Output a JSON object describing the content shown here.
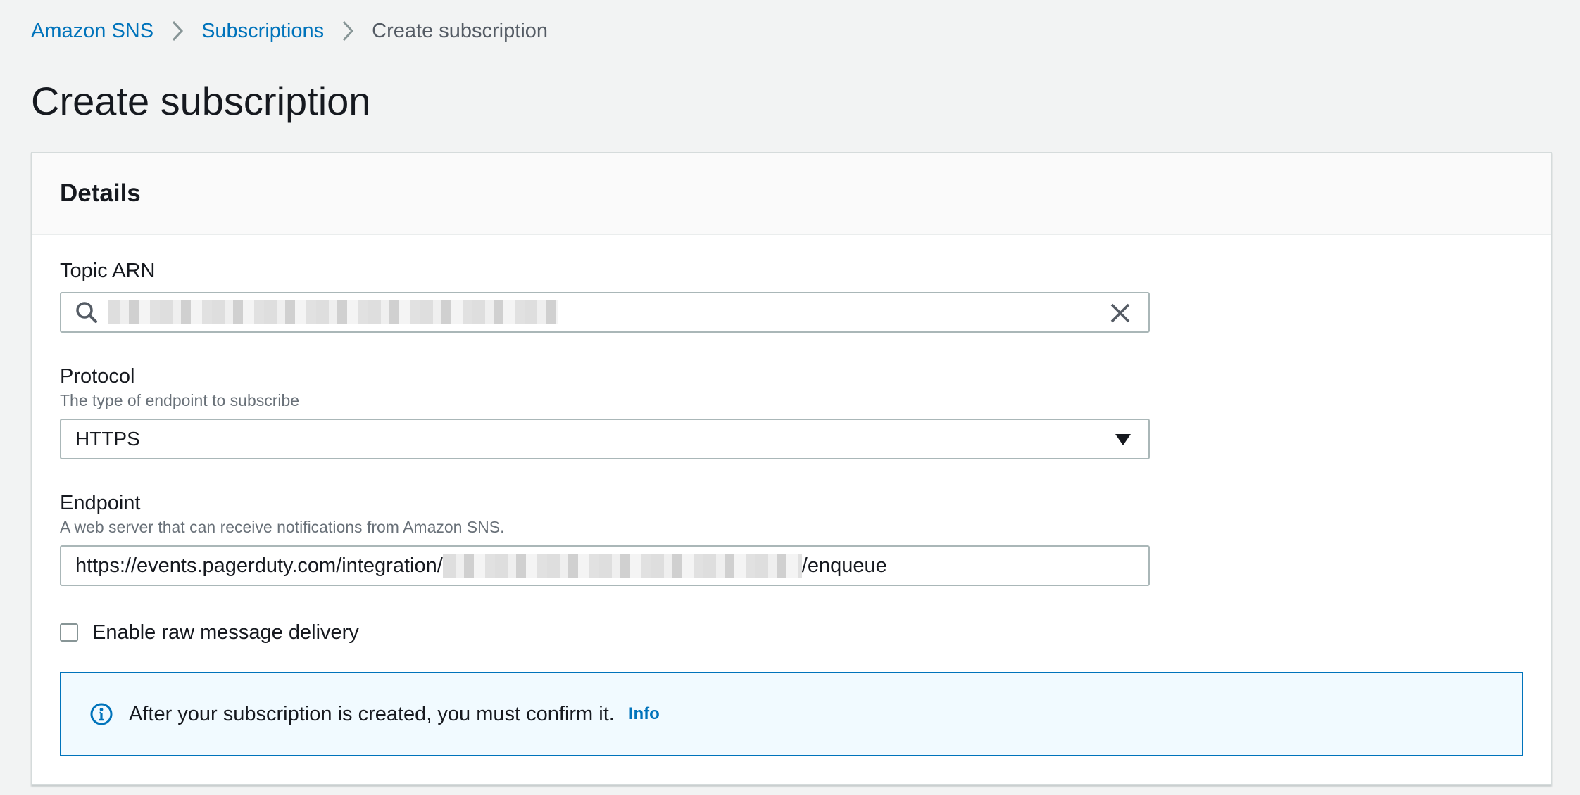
{
  "breadcrumb": {
    "items": [
      {
        "label": "Amazon SNS"
      },
      {
        "label": "Subscriptions"
      },
      {
        "label": "Create subscription"
      }
    ]
  },
  "page": {
    "title": "Create subscription"
  },
  "details": {
    "title": "Details",
    "topic_arn": {
      "label": "Topic ARN",
      "value": ""
    },
    "protocol": {
      "label": "Protocol",
      "description": "The type of endpoint to subscribe",
      "selected": "HTTPS"
    },
    "endpoint": {
      "label": "Endpoint",
      "description": "A web server that can receive notifications from Amazon SNS.",
      "value_prefix": "https://events.pagerduty.com/integration/",
      "value_suffix": "/enqueue"
    },
    "raw_delivery": {
      "label": "Enable raw message delivery",
      "checked": false
    },
    "alert": {
      "text": "After your subscription is created, you must confirm it.",
      "link": "Info"
    }
  },
  "colors": {
    "link": "#0073bb",
    "background": "#f2f3f3",
    "alert_background": "#f1faff",
    "alert_border": "#0073bb"
  },
  "icons": {
    "breadcrumb_separator": "chevron-right-icon",
    "topic_search": "search-icon",
    "topic_clear": "close-icon",
    "protocol_dropdown": "caret-down-icon",
    "alert": "info-icon"
  }
}
